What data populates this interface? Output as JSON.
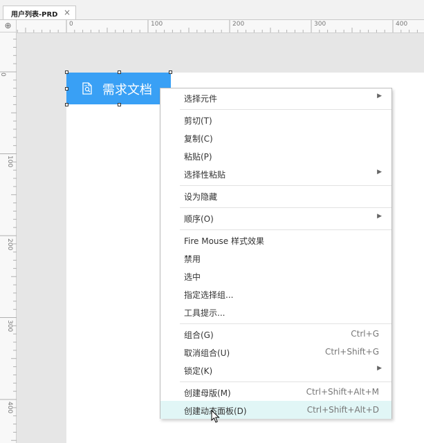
{
  "tab": {
    "title": "用户列表-PRD",
    "close": "×"
  },
  "rulers": {
    "corner_icon": "⊕",
    "top_labels": [
      "0",
      "100",
      "200",
      "300",
      "400"
    ],
    "left_labels": [
      "0",
      "100",
      "200",
      "300",
      "400"
    ]
  },
  "widget": {
    "label": "需求文档",
    "icon": "document-search-icon"
  },
  "menu": {
    "items": [
      {
        "label": "选择元件",
        "submenu": true
      },
      {
        "label": "剪切(T)"
      },
      {
        "label": "复制(C)"
      },
      {
        "label": "粘贴(P)"
      },
      {
        "label": "选择性粘贴",
        "submenu": true
      },
      {
        "label": "设为隐藏"
      },
      {
        "label": "顺序(O)",
        "submenu": true
      },
      {
        "label": "Fire Mouse 样式效果"
      },
      {
        "label": "禁用"
      },
      {
        "label": "选中"
      },
      {
        "label": "指定选择组..."
      },
      {
        "label": "工具提示..."
      },
      {
        "label": "组合(G)",
        "shortcut": "Ctrl+G"
      },
      {
        "label": "取消组合(U)",
        "shortcut": "Ctrl+Shift+G"
      },
      {
        "label": "锁定(K)",
        "submenu": true
      },
      {
        "label": "创建母版(M)",
        "shortcut": "Ctrl+Shift+Alt+M"
      },
      {
        "label": "创建动态面板(D)",
        "shortcut": "Ctrl+Shift+Alt+D",
        "highlighted": true
      }
    ],
    "submenu_arrow": "▶"
  },
  "colors": {
    "widget_fill": "#39a0f5",
    "highlight": "#e1f6f6",
    "canvas_bg": "#e6e6e6"
  }
}
